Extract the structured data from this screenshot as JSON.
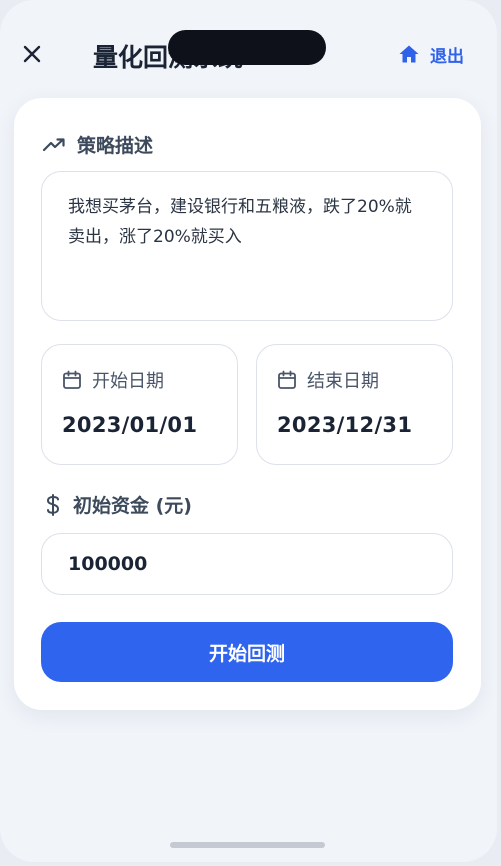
{
  "header": {
    "title": "量化回测系统",
    "exit_label": "退出"
  },
  "strategy": {
    "label": "策略描述",
    "text": "我想买茅台，建设银行和五粮液，跌了20%就卖出，涨了20%就买入"
  },
  "dates": {
    "start_label": "开始日期",
    "start_value": "2023/01/01",
    "end_label": "结束日期",
    "end_value": "2023/12/31"
  },
  "capital": {
    "label": "初始资金 (元)",
    "value": "100000"
  },
  "actions": {
    "start_label": "开始回测"
  },
  "colors": {
    "accent": "#2e64ee",
    "title": "#1b2435"
  },
  "icons": [
    "close-icon",
    "home-icon",
    "trending-up-icon",
    "calendar-icon",
    "dollar-icon"
  ]
}
